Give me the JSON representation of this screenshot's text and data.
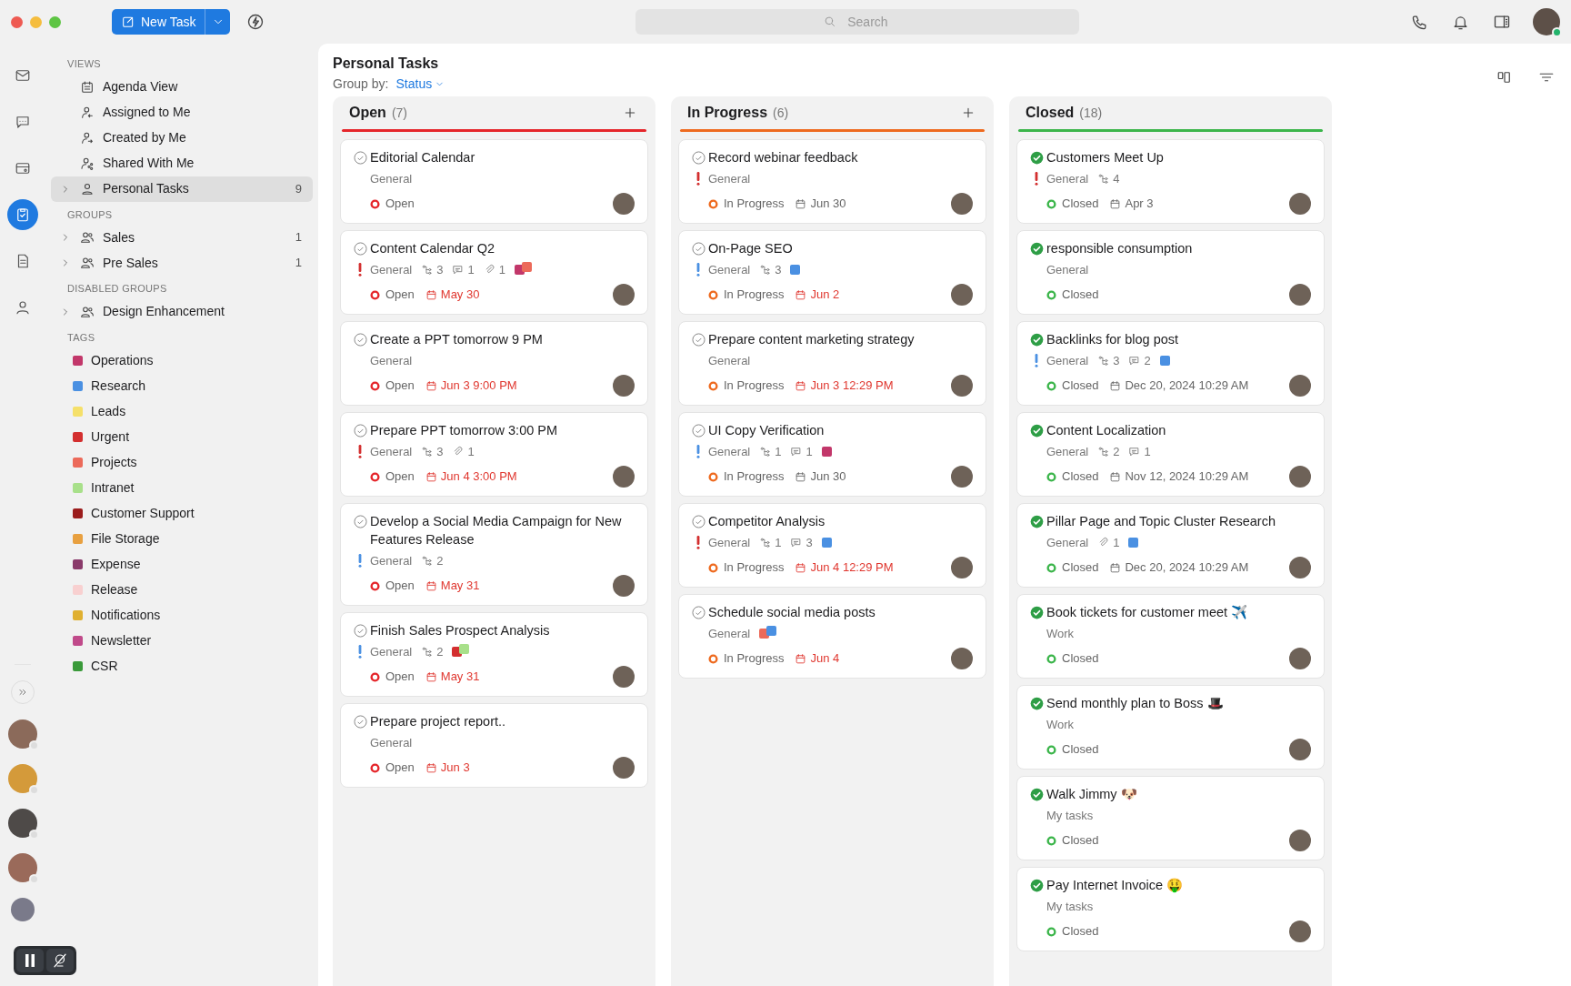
{
  "toolbar": {
    "new_task": "New Task",
    "search": {
      "placeholder": "Search"
    },
    "user": {
      "online": true
    }
  },
  "rail": [
    {
      "kind": "mail",
      "selected": false
    },
    {
      "kind": "chat",
      "selected": false
    },
    {
      "kind": "drive",
      "selected": false
    },
    {
      "kind": "tasks",
      "selected": true
    },
    {
      "kind": "notes",
      "selected": false
    },
    {
      "kind": "contacts",
      "selected": false
    }
  ],
  "contacts": [
    {
      "kind": "person",
      "online": false
    },
    {
      "kind": "person",
      "online": false
    },
    {
      "kind": "person",
      "online": false
    },
    {
      "kind": "person",
      "online": false
    },
    {
      "kind": "group"
    }
  ],
  "sidebar": {
    "sections": [
      {
        "title": "VIEWS",
        "items": [
          {
            "kind": "agenda",
            "label": "Agenda View",
            "selected": false
          },
          {
            "kind": "assigned",
            "label": "Assigned to Me",
            "selected": false
          },
          {
            "kind": "created",
            "label": "Created by Me",
            "selected": false
          },
          {
            "kind": "shared",
            "label": "Shared With Me",
            "selected": false
          },
          {
            "kind": "person",
            "label": "Personal Tasks",
            "count": "9",
            "expanded": false,
            "selected": true
          }
        ]
      },
      {
        "title": "GROUPS",
        "items": [
          {
            "kind": "group",
            "label": "Sales",
            "count": "1",
            "expanded": false,
            "selected": false
          },
          {
            "kind": "group",
            "label": "Pre Sales",
            "count": "1",
            "expanded": false,
            "selected": false
          }
        ]
      },
      {
        "title": "DISABLED GROUPS",
        "items": [
          {
            "kind": "group",
            "label": "Design Enhancement",
            "expanded": false,
            "selected": false
          }
        ]
      }
    ],
    "tags_title": "TAGS",
    "tags": [
      {
        "label": "Operations",
        "color": "#c2376a"
      },
      {
        "label": "Research",
        "color": "#4a90e2"
      },
      {
        "label": "Leads",
        "color": "#f5e06a"
      },
      {
        "label": "Urgent",
        "color": "#d32f2f"
      },
      {
        "label": "Projects",
        "color": "#ec6a5a"
      },
      {
        "label": "Intranet",
        "color": "#a8e08a"
      },
      {
        "label": "Customer Support",
        "color": "#9b1c1c"
      },
      {
        "label": "File Storage",
        "color": "#e8a040"
      },
      {
        "label": "Expense",
        "color": "#8a3a6a"
      },
      {
        "label": "Release",
        "color": "#f8d0d0"
      },
      {
        "label": "Notifications",
        "color": "#e0b030"
      },
      {
        "label": "Newsletter",
        "color": "#c04a8a"
      },
      {
        "label": "CSR",
        "color": "#3a9a3a"
      }
    ]
  },
  "main": {
    "title": "Personal Tasks",
    "group_by_label": "Group by:",
    "group_by_value": "Status"
  },
  "columns": [
    {
      "title": "Open",
      "count": "(7)",
      "color": "#e5262b",
      "can_add": true,
      "cards": [
        {
          "title": "Editorial Calendar",
          "done": false,
          "list": "General",
          "status": "Open"
        },
        {
          "title": "Content Calendar Q2",
          "done": false,
          "priority": {
            "color": "#d32f2f"
          },
          "list": "General",
          "subtasks": "3",
          "comments": "1",
          "attachments": "1",
          "tags": [
            {
              "color": "#c2376a"
            },
            {
              "color": "#ec6a5a"
            }
          ],
          "status": "Open",
          "due": "May 30",
          "overdue": true
        },
        {
          "title": "Create a PPT tomorrow 9 PM",
          "done": false,
          "list": "General",
          "status": "Open",
          "due": "Jun 3 9:00 PM",
          "overdue": true
        },
        {
          "title": "Prepare PPT tomorrow 3:00 PM",
          "done": false,
          "priority": {
            "color": "#d32f2f"
          },
          "list": "General",
          "subtasks": "3",
          "attachments": "1",
          "status": "Open",
          "due": "Jun 4 3:00 PM",
          "overdue": true
        },
        {
          "title": "Develop a Social Media Campaign for New Features Release",
          "done": false,
          "priority": {
            "color": "#4a90e2"
          },
          "list": "General",
          "subtasks": "2",
          "status": "Open",
          "due": "May 31",
          "overdue": true
        },
        {
          "title": "Finish Sales Prospect Analysis",
          "done": false,
          "priority": {
            "color": "#4a90e2"
          },
          "list": "General",
          "subtasks": "2",
          "tags": [
            {
              "color": "#d32f2f"
            },
            {
              "color": "#a8e08a"
            }
          ],
          "status": "Open",
          "due": "May 31",
          "overdue": true
        },
        {
          "title": "Prepare project report..",
          "done": false,
          "list": "General",
          "status": "Open",
          "due": "Jun 3",
          "overdue": true
        }
      ]
    },
    {
      "title": "In Progress",
      "count": "(6)",
      "color": "#ee6a1f",
      "can_add": true,
      "cards": [
        {
          "title": "Record webinar feedback",
          "done": false,
          "priority": {
            "color": "#d32f2f"
          },
          "list": "General",
          "status": "In Progress",
          "due": "Jun 30",
          "overdue": false
        },
        {
          "title": "On-Page SEO",
          "done": false,
          "priority": {
            "color": "#4a90e2"
          },
          "list": "General",
          "subtasks": "3",
          "tags": [
            {
              "color": "#4a90e2"
            }
          ],
          "status": "In Progress",
          "due": "Jun 2",
          "overdue": true
        },
        {
          "title": "Prepare content marketing strategy",
          "done": false,
          "list": "General",
          "status": "In Progress",
          "due": "Jun 3 12:29 PM",
          "overdue": true
        },
        {
          "title": "UI Copy Verification",
          "done": false,
          "priority": {
            "color": "#4a90e2"
          },
          "list": "General",
          "subtasks": "1",
          "comments": "1",
          "tags": [
            {
              "color": "#c2376a"
            }
          ],
          "status": "In Progress",
          "due": "Jun 30",
          "overdue": false
        },
        {
          "title": "Competitor Analysis",
          "done": false,
          "priority": {
            "color": "#d32f2f"
          },
          "list": "General",
          "subtasks": "1",
          "comments": "3",
          "tags": [
            {
              "color": "#4a90e2"
            }
          ],
          "status": "In Progress",
          "due": "Jun 4 12:29 PM",
          "overdue": true
        },
        {
          "title": "Schedule social media posts",
          "done": false,
          "list": "General",
          "tags": [
            {
              "color": "#ec6a5a"
            },
            {
              "color": "#4a90e2"
            }
          ],
          "status": "In Progress",
          "due": "Jun 4",
          "overdue": true
        }
      ]
    },
    {
      "title": "Closed",
      "count": "(18)",
      "color": "#3bb54a",
      "can_add": false,
      "cards": [
        {
          "title": "Customers Meet Up",
          "done": true,
          "priority": {
            "color": "#d32f2f"
          },
          "list": "General",
          "subtasks": "4",
          "status": "Closed",
          "due": "Apr 3",
          "overdue": false
        },
        {
          "title": "responsible consumption",
          "done": true,
          "list": "General",
          "status": "Closed"
        },
        {
          "title": "Backlinks for blog post",
          "done": true,
          "priority": {
            "color": "#4a90e2"
          },
          "list": "General",
          "subtasks": "3",
          "comments": "2",
          "tags": [
            {
              "color": "#4a90e2"
            }
          ],
          "status": "Closed",
          "due": "Dec 20, 2024 10:29 AM",
          "overdue": false
        },
        {
          "title": "Content Localization",
          "done": true,
          "list": "General",
          "subtasks": "2",
          "comments": "1",
          "status": "Closed",
          "due": "Nov 12, 2024 10:29 AM",
          "overdue": false
        },
        {
          "title": "Pillar Page and Topic Cluster Research",
          "done": true,
          "list": "General",
          "attachments": "1",
          "tags": [
            {
              "color": "#4a90e2"
            }
          ],
          "status": "Closed",
          "due": "Dec 20, 2024 10:29 AM",
          "overdue": false
        },
        {
          "title": "Book tickets for customer meet ✈️",
          "done": true,
          "list": "Work",
          "status": "Closed"
        },
        {
          "title": "Send monthly plan to Boss 🎩",
          "done": true,
          "list": "Work",
          "status": "Closed"
        },
        {
          "title": "Walk Jimmy 🐶",
          "done": true,
          "list": "My tasks",
          "status": "Closed"
        },
        {
          "title": "Pay Internet Invoice 🤑",
          "done": true,
          "list": "My tasks",
          "status": "Closed"
        }
      ]
    }
  ]
}
